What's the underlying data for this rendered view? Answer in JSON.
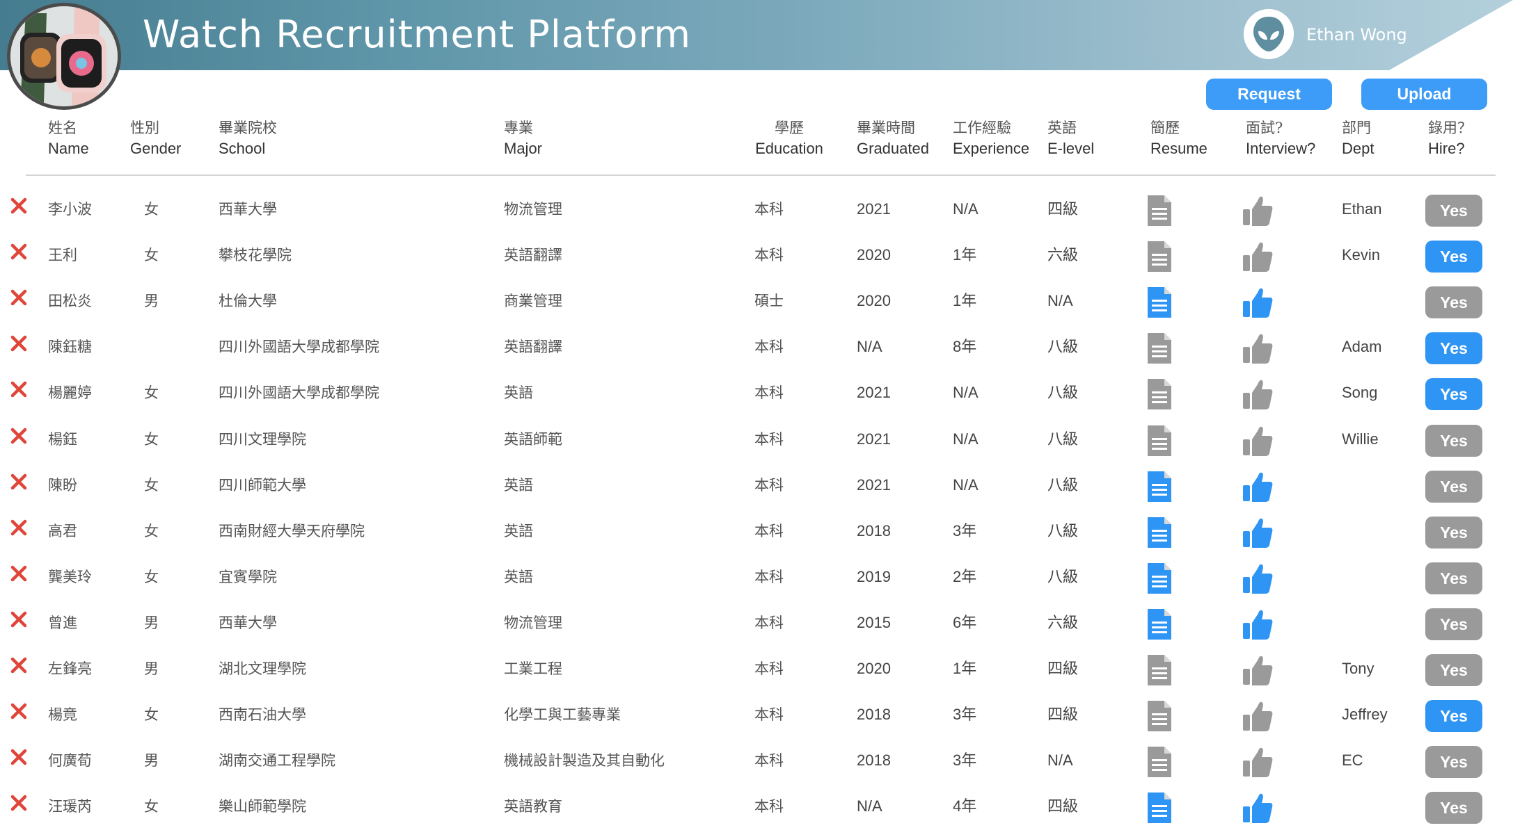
{
  "header": {
    "app_title": "Watch Recruitment Platform",
    "user_name": "Ethan Wong"
  },
  "actions": {
    "request_label": "Request",
    "upload_label": "Upload"
  },
  "colors": {
    "accent_blue": "#2f95f5",
    "button_blue": "#3c9cf7",
    "inactive_gray": "#9a9a9a",
    "icon_gray": "#9a9a9a",
    "delete_red": "#e0453a"
  },
  "columns": {
    "name": {
      "zh": "姓名",
      "en": "Name"
    },
    "gender": {
      "zh": "性別",
      "en": "Gender"
    },
    "school": {
      "zh": "畢業院校",
      "en": "School"
    },
    "major": {
      "zh": "專業",
      "en": "Major"
    },
    "education": {
      "zh": "學歷",
      "en": "Education"
    },
    "graduated": {
      "zh": "畢業時間",
      "en": "Graduated"
    },
    "experience": {
      "zh": "工作經驗",
      "en": "Experience"
    },
    "elevel": {
      "zh": "英語",
      "en": "E-level"
    },
    "resume": {
      "zh": "簡歷",
      "en": "Resume"
    },
    "interview": {
      "zh": "面試?",
      "en": "Interview?"
    },
    "dept": {
      "zh": "部門",
      "en": "Dept"
    },
    "hire": {
      "zh": "錄用？",
      "en": "Hire?"
    }
  },
  "icons": {
    "logo": "apple-watch-logo",
    "avatar": "alien-avatar-icon",
    "delete": "close-x-icon",
    "resume": "document-icon",
    "interview": "thumbs-up-icon"
  },
  "hire_label": "Yes",
  "rows": [
    {
      "name": "李小波",
      "gender": "女",
      "school": "西華大學",
      "major": "物流管理",
      "education": "本科",
      "graduated": "2021",
      "experience": "N/A",
      "elevel": "四級",
      "resume_active": false,
      "interview_active": false,
      "dept": "Ethan",
      "hired": false
    },
    {
      "name": "王利",
      "gender": "女",
      "school": "攀枝花學院",
      "major": "英語翻譯",
      "education": "本科",
      "graduated": "2020",
      "experience": "1年",
      "elevel": "六級",
      "resume_active": false,
      "interview_active": false,
      "dept": "Kevin",
      "hired": true
    },
    {
      "name": "田松炎",
      "gender": "男",
      "school": "杜倫大學",
      "major": "商業管理",
      "education": "碩士",
      "graduated": "2020",
      "experience": "1年",
      "elevel": "N/A",
      "resume_active": true,
      "interview_active": true,
      "dept": "",
      "hired": false
    },
    {
      "name": "陳鈺糖",
      "gender": "",
      "school": "四川外國語大學成都學院",
      "major": "英語翻譯",
      "education": "本科",
      "graduated": "N/A",
      "experience": "8年",
      "elevel": "八級",
      "resume_active": false,
      "interview_active": false,
      "dept": "Adam",
      "hired": true
    },
    {
      "name": "楊麗婷",
      "gender": "女",
      "school": "四川外國語大學成都學院",
      "major": "英語",
      "education": "本科",
      "graduated": "2021",
      "experience": "N/A",
      "elevel": "八級",
      "resume_active": false,
      "interview_active": false,
      "dept": "Song",
      "hired": true
    },
    {
      "name": "楊鈺",
      "gender": "女",
      "school": "四川文理學院",
      "major": "英語師範",
      "education": "本科",
      "graduated": "2021",
      "experience": "N/A",
      "elevel": "八級",
      "resume_active": false,
      "interview_active": false,
      "dept": "Willie",
      "hired": false
    },
    {
      "name": "陳盼",
      "gender": "女",
      "school": "四川師範大學",
      "major": "英語",
      "education": "本科",
      "graduated": "2021",
      "experience": "N/A",
      "elevel": "八級",
      "resume_active": true,
      "interview_active": true,
      "dept": "",
      "hired": false
    },
    {
      "name": "高君",
      "gender": "女",
      "school": "西南財經大學天府學院",
      "major": "英語",
      "education": "本科",
      "graduated": "2018",
      "experience": "3年",
      "elevel": "八級",
      "resume_active": true,
      "interview_active": true,
      "dept": "",
      "hired": false
    },
    {
      "name": "龔美玲",
      "gender": "女",
      "school": "宜賓學院",
      "major": "英語",
      "education": "本科",
      "graduated": "2019",
      "experience": "2年",
      "elevel": "八級",
      "resume_active": true,
      "interview_active": true,
      "dept": "",
      "hired": false
    },
    {
      "name": "曾進",
      "gender": "男",
      "school": "西華大學",
      "major": "物流管理",
      "education": "本科",
      "graduated": "2015",
      "experience": "6年",
      "elevel": "六級",
      "resume_active": true,
      "interview_active": true,
      "dept": "",
      "hired": false
    },
    {
      "name": "左鋒亮",
      "gender": "男",
      "school": "湖北文理學院",
      "major": "工業工程",
      "education": "本科",
      "graduated": "2020",
      "experience": "1年",
      "elevel": "四級",
      "resume_active": false,
      "interview_active": false,
      "dept": "Tony",
      "hired": false
    },
    {
      "name": "楊竟",
      "gender": "女",
      "school": "西南石油大學",
      "major": " 化學工與工藝專業",
      "education": "本科",
      "graduated": "2018",
      "experience": "3年",
      "elevel": "四級",
      "resume_active": false,
      "interview_active": false,
      "dept": "Jeffrey",
      "hired": true
    },
    {
      "name": "何廣荀",
      "gender": "男",
      "school": "湖南交通工程學院",
      "major": "機械設計製造及其自動化",
      "education": "本科",
      "graduated": "2018",
      "experience": "3年",
      "elevel": "N/A",
      "resume_active": false,
      "interview_active": false,
      "dept": "EC",
      "hired": false
    },
    {
      "name": "汪瑗芮",
      "gender": "女",
      "school": "樂山師範學院",
      "major": "英語教育",
      "education": "本科",
      "graduated": "N/A",
      "experience": "4年",
      "elevel": "四級",
      "resume_active": true,
      "interview_active": true,
      "dept": "",
      "hired": false
    }
  ]
}
